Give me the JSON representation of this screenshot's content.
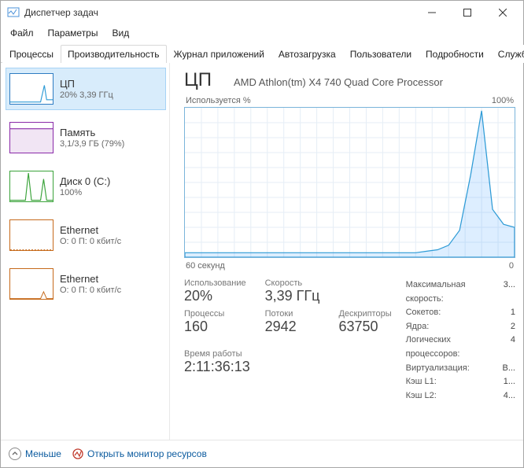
{
  "window": {
    "title": "Диспетчер задач"
  },
  "menu": {
    "file": "Файл",
    "options": "Параметры",
    "view": "Вид"
  },
  "tabs": {
    "processes": "Процессы",
    "performance": "Производительность",
    "apphistory": "Журнал приложений",
    "startup": "Автозагрузка",
    "users": "Пользователи",
    "details": "Подробности",
    "services": "Службы"
  },
  "sidebar": {
    "cpu": {
      "title": "ЦП",
      "sub": "20% 3,39 ГГц"
    },
    "mem": {
      "title": "Память",
      "sub": "3,1/3,9 ГБ (79%)"
    },
    "disk": {
      "title": "Диск 0 (C:)",
      "sub": "100%"
    },
    "eth0": {
      "title": "Ethernet",
      "sub": "О: 0 П: 0 кбит/с"
    },
    "eth1": {
      "title": "Ethernet",
      "sub": "О: 0 П: 0 кбит/с"
    }
  },
  "main": {
    "heading": "ЦП",
    "subheading": "AMD Athlon(tm) X4 740 Quad Core Processor",
    "chart_top_left": "Используется %",
    "chart_top_right": "100%",
    "chart_bottom_left": "60 секунд",
    "chart_bottom_right": "0"
  },
  "stats": {
    "util_label": "Использование",
    "util_val": "20%",
    "speed_label": "Скорость",
    "speed_val": "3,39 ГГц",
    "proc_label": "Процессы",
    "proc_val": "160",
    "thread_label": "Потоки",
    "thread_val": "2942",
    "handle_label": "Дескрипторы",
    "handle_val": "63750",
    "uptime_label": "Время работы",
    "uptime_val": "2:11:36:13"
  },
  "kv": {
    "maxspeed_k": "Максимальная скорость:",
    "maxspeed_v": "3...",
    "sockets_k": "Сокетов:",
    "sockets_v": "1",
    "cores_k": "Ядра:",
    "cores_v": "2",
    "logical_k": "Логических процессоров:",
    "logical_v": "4",
    "virt_k": "Виртуализация:",
    "virt_v": "В...",
    "l1_k": "Кэш L1:",
    "l1_v": "1...",
    "l2_k": "Кэш L2:",
    "l2_v": "4..."
  },
  "footer": {
    "less": "Меньше",
    "resmon": "Открыть монитор ресурсов"
  },
  "chart_data": {
    "type": "line",
    "title": "Используется %",
    "xlabel": "60 секунд",
    "ylabel": "%",
    "ylim": [
      0,
      100
    ],
    "xlim_seconds": [
      60,
      0
    ],
    "x_seconds_ago": [
      60,
      58,
      56,
      54,
      52,
      50,
      48,
      46,
      44,
      42,
      40,
      38,
      36,
      34,
      32,
      30,
      28,
      26,
      24,
      22,
      20,
      18,
      16,
      14,
      12,
      10,
      8,
      6,
      4,
      2,
      0
    ],
    "values_percent": [
      3,
      3,
      3,
      3,
      3,
      3,
      3,
      3,
      3,
      3,
      3,
      3,
      3,
      3,
      3,
      3,
      3,
      3,
      3,
      3,
      3,
      3,
      4,
      5,
      8,
      18,
      55,
      98,
      32,
      22,
      20
    ]
  }
}
